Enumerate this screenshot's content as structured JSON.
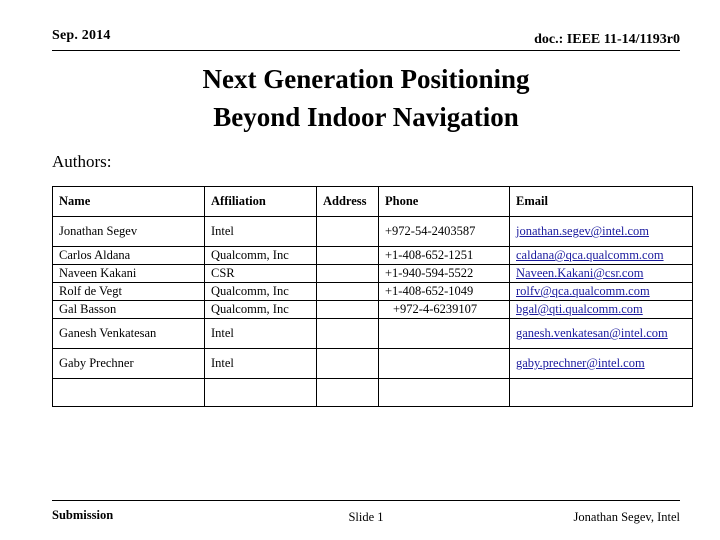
{
  "header": {
    "date": "Sep. 2014",
    "doc": "doc.: IEEE 11-14/1193r0"
  },
  "title": {
    "line1": "Next Generation Positioning",
    "line2": "Beyond Indoor Navigation"
  },
  "authors_label": "Authors:",
  "table": {
    "columns": [
      "Name",
      "Affiliation",
      "Address",
      "Phone",
      "Email"
    ],
    "rows": [
      {
        "name": "Jonathan Segev",
        "affiliation": "Intel",
        "address": "",
        "phone": "+972-54-2403587",
        "email": "jonathan.segev@intel.com"
      },
      {
        "name": "Carlos Aldana",
        "affiliation": "Qualcomm, Inc",
        "address": "",
        "phone": "+1-408-652-1251",
        "email": "caldana@qca.qualcomm.com"
      },
      {
        "name": "Naveen Kakani",
        "affiliation": "CSR",
        "address": "",
        "phone": "+1-940-594-5522",
        "email": "Naveen.Kakani@csr.com"
      },
      {
        "name": "Rolf de Vegt",
        "affiliation": "Qualcomm, Inc",
        "address": "",
        "phone": "+1-408-652-1049",
        "email": "rolfv@qca.qualcomm.com"
      },
      {
        "name": "Gal Basson",
        "affiliation": "Qualcomm, Inc",
        "address": "",
        "phone": "+972-4-6239107",
        "email": "bgal@qti.qualcomm.com"
      },
      {
        "name": "Ganesh Venkatesan",
        "affiliation": "Intel",
        "address": "",
        "phone": "",
        "email": "ganesh.venkatesan@intel.com"
      },
      {
        "name": "Gaby Prechner",
        "affiliation": "Intel",
        "address": "",
        "phone": "",
        "email": "gaby.prechner@intel.com"
      },
      {
        "name": "",
        "affiliation": "",
        "address": "",
        "phone": "",
        "email": ""
      }
    ]
  },
  "footer": {
    "left": "Submission",
    "center": "Slide 1",
    "right": "Jonathan Segev, Intel"
  },
  "colors": {
    "email_link": "#1b1b9e",
    "text": "#000000",
    "background": "#ffffff"
  }
}
